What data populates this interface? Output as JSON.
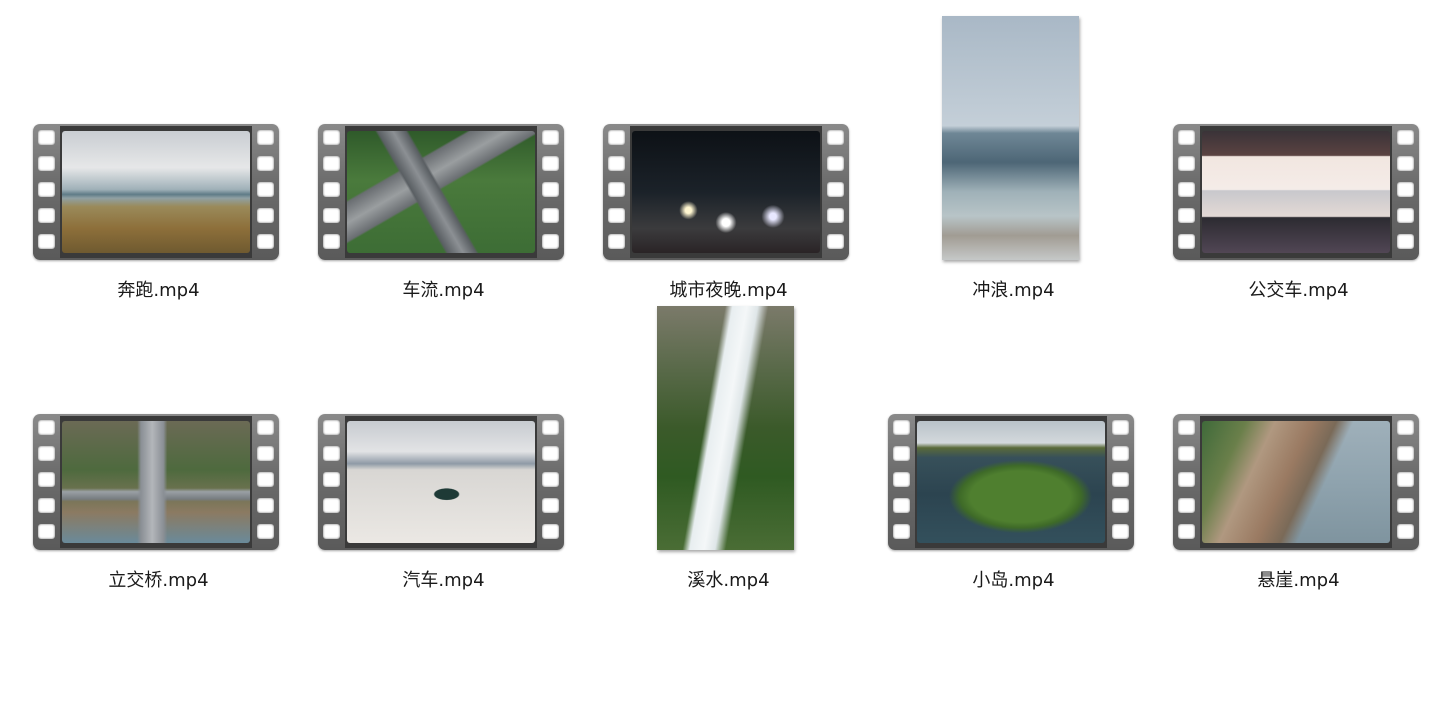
{
  "files": [
    {
      "name": "奔跑.mp4",
      "kind": "landscape",
      "scene": "sc-run"
    },
    {
      "name": "车流.mp4",
      "kind": "landscape",
      "scene": "sc-traffic"
    },
    {
      "name": "城市夜晚.mp4",
      "kind": "landscape",
      "scene": "sc-night"
    },
    {
      "name": "冲浪.mp4",
      "kind": "portrait",
      "scene": "sc-surf"
    },
    {
      "name": "公交车.mp4",
      "kind": "landscape",
      "scene": "sc-bus"
    },
    {
      "name": "立交桥.mp4",
      "kind": "landscape",
      "scene": "sc-bridge"
    },
    {
      "name": "汽车.mp4",
      "kind": "landscape",
      "scene": "sc-car"
    },
    {
      "name": "溪水.mp4",
      "kind": "portrait",
      "scene": "sc-stream"
    },
    {
      "name": "小岛.mp4",
      "kind": "landscape",
      "scene": "sc-island"
    },
    {
      "name": "悬崖.mp4",
      "kind": "landscape",
      "scene": "sc-cliff"
    }
  ]
}
